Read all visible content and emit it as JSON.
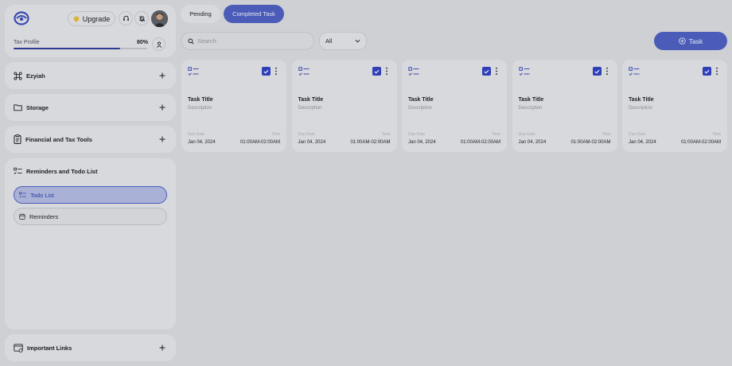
{
  "header": {
    "upgrade_label": "Upgrade",
    "tax_profile_label": "Tax Profile",
    "tax_profile_percent_text": "80%",
    "tax_profile_progress": 0.8
  },
  "sidebar": {
    "sections": [
      {
        "label": "Ezyiah",
        "icon": "command-icon"
      },
      {
        "label": "Storage",
        "icon": "folder-icon"
      },
      {
        "label": "Financial and Tax Tools",
        "icon": "clipboard-icon"
      }
    ],
    "reminders": {
      "label": "Reminders and Todo List",
      "items": [
        {
          "label": "Todo List",
          "active": true
        },
        {
          "label": "Reminders",
          "active": false
        }
      ]
    },
    "important_links_label": "Important Links"
  },
  "tabs": {
    "pending": "Pending",
    "completed": "Completed Task"
  },
  "search": {
    "placeholder": "Search",
    "value": ""
  },
  "filter": {
    "selected": "All"
  },
  "task_button_label": "Task",
  "tasks": [
    {
      "title": "Task Title",
      "description": "Description",
      "due_label": "Due Date",
      "due": "Jan 04, 2024",
      "time_label": "Time",
      "time": "01:00AM-02:00AM",
      "checked": true
    },
    {
      "title": "Task Title",
      "description": "Description",
      "due_label": "Due Date",
      "due": "Jan 04, 2024",
      "time_label": "Time",
      "time": "01:00AM-02:00AM",
      "checked": true
    },
    {
      "title": "Task Title",
      "description": "Description",
      "due_label": "Due Date",
      "due": "Jan 04, 2024",
      "time_label": "Time",
      "time": "01:00AM-02:00AM",
      "checked": true
    },
    {
      "title": "Task Title",
      "description": "Description",
      "due_label": "Due Date",
      "due": "Jan 04, 2024",
      "time_label": "Time",
      "time": "01:00AM-02:00AM",
      "checked": true
    },
    {
      "title": "Task Title",
      "description": "Description",
      "due_label": "Due Date",
      "due": "Jan 04, 2024",
      "time_label": "Time",
      "time": "01:00AM-02:00AM",
      "checked": true
    }
  ],
  "colors": {
    "accent": "#4a5cb8",
    "checkbox": "#2f3fb8",
    "background": "#cfd0d4",
    "card": "#d8d9dd",
    "upgrade_icon": "#d9b43a"
  }
}
